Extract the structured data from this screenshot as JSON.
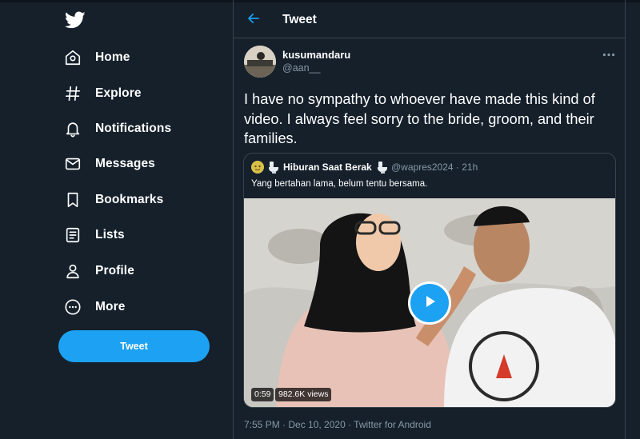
{
  "sidebar": {
    "logo_icon": "twitter-bird-icon",
    "items": [
      {
        "label": "Home",
        "icon": "home-icon"
      },
      {
        "label": "Explore",
        "icon": "hashtag-icon"
      },
      {
        "label": "Notifications",
        "icon": "bell-icon"
      },
      {
        "label": "Messages",
        "icon": "envelope-icon"
      },
      {
        "label": "Bookmarks",
        "icon": "bookmark-icon"
      },
      {
        "label": "Lists",
        "icon": "list-icon"
      },
      {
        "label": "Profile",
        "icon": "person-icon"
      },
      {
        "label": "More",
        "icon": "more-circle-icon"
      }
    ],
    "tweet_button": "Tweet"
  },
  "header": {
    "title": "Tweet",
    "back_icon": "arrow-left-icon"
  },
  "tweet": {
    "display_name": "kusumandaru",
    "handle": "@aan__",
    "text": "I have no sympathy to whoever have made this kind of video. I always feel sorry to the bride, groom, and their families.",
    "timestamp": "7:55 PM · Dec 10, 2020 · Twitter for Android",
    "more_icon": "ellipsis-icon"
  },
  "quote": {
    "name": "Hiburan Saat Berak",
    "handle_time": "@wapres2024 · 21h",
    "text": "Yang bertahan lama, belum tentu bersama.",
    "emoji_icon": "toilet-emoji-icon",
    "video": {
      "duration": "0:59",
      "views": "982.6K views",
      "play_icon": "play-icon"
    }
  },
  "colors": {
    "background": "#15202b",
    "border": "#38444d",
    "accent": "#1da1f2",
    "secondary_text": "#8899a6"
  }
}
